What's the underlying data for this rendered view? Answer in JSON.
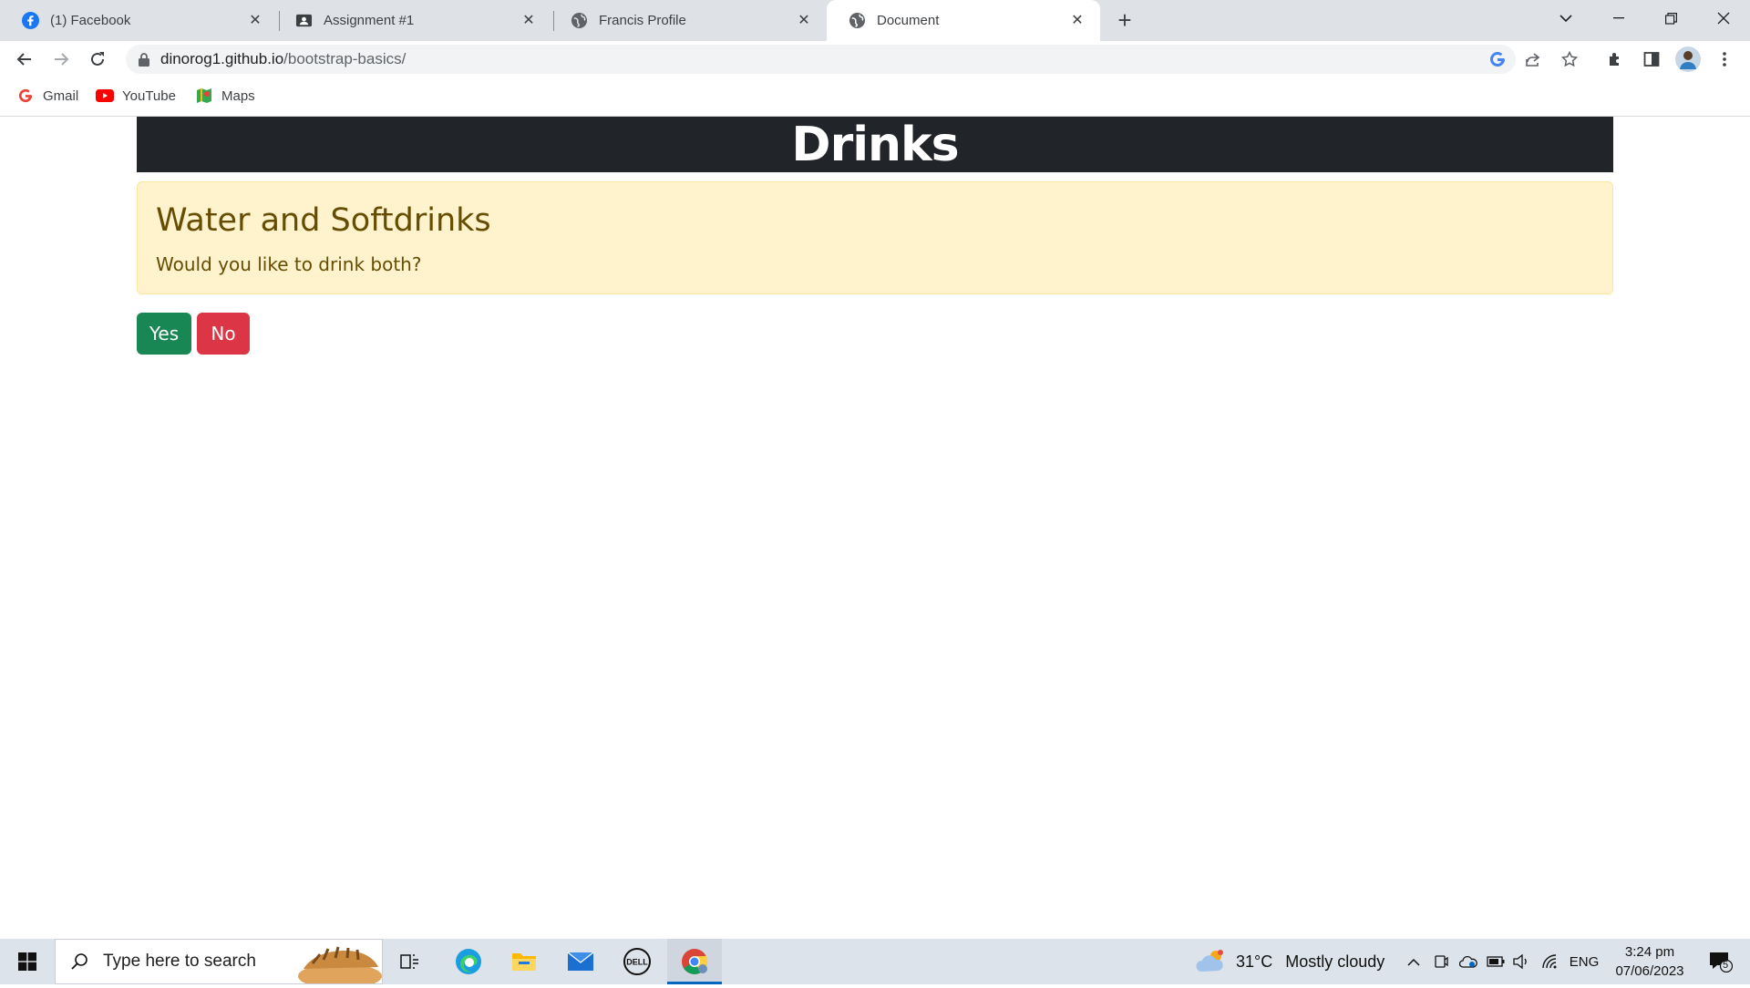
{
  "browser": {
    "tabs": [
      {
        "title": "(1) Facebook",
        "icon": "facebook-icon",
        "active": false
      },
      {
        "title": "Assignment #1",
        "icon": "classroom-icon",
        "active": false
      },
      {
        "title": "Francis Profile",
        "icon": "globe-icon",
        "active": false
      },
      {
        "title": "Document",
        "icon": "globe-icon",
        "active": true
      }
    ],
    "url_host": "dinorog1.github.io",
    "url_path": "/bootstrap-basics/",
    "bookmarks": [
      {
        "label": "Gmail",
        "icon": "google-icon"
      },
      {
        "label": "YouTube",
        "icon": "youtube-icon"
      },
      {
        "label": "Maps",
        "icon": "maps-icon"
      }
    ]
  },
  "page": {
    "title": "Drinks",
    "alert_heading": "Water and Softdrinks",
    "alert_text": "Would you like to drink both?",
    "yes_label": "Yes",
    "no_label": "No",
    "colors": {
      "header_bg": "#212529",
      "alert_bg": "#fff3cd",
      "alert_text": "#664d03",
      "yes_bg": "#198754",
      "no_bg": "#dc3545"
    }
  },
  "taskbar": {
    "search_placeholder": "Type here to search",
    "weather_temp": "31°C",
    "weather_desc": "Mostly cloudy",
    "language": "ENG",
    "time": "3:24 pm",
    "date": "07/06/2023",
    "notification_count": "5"
  }
}
